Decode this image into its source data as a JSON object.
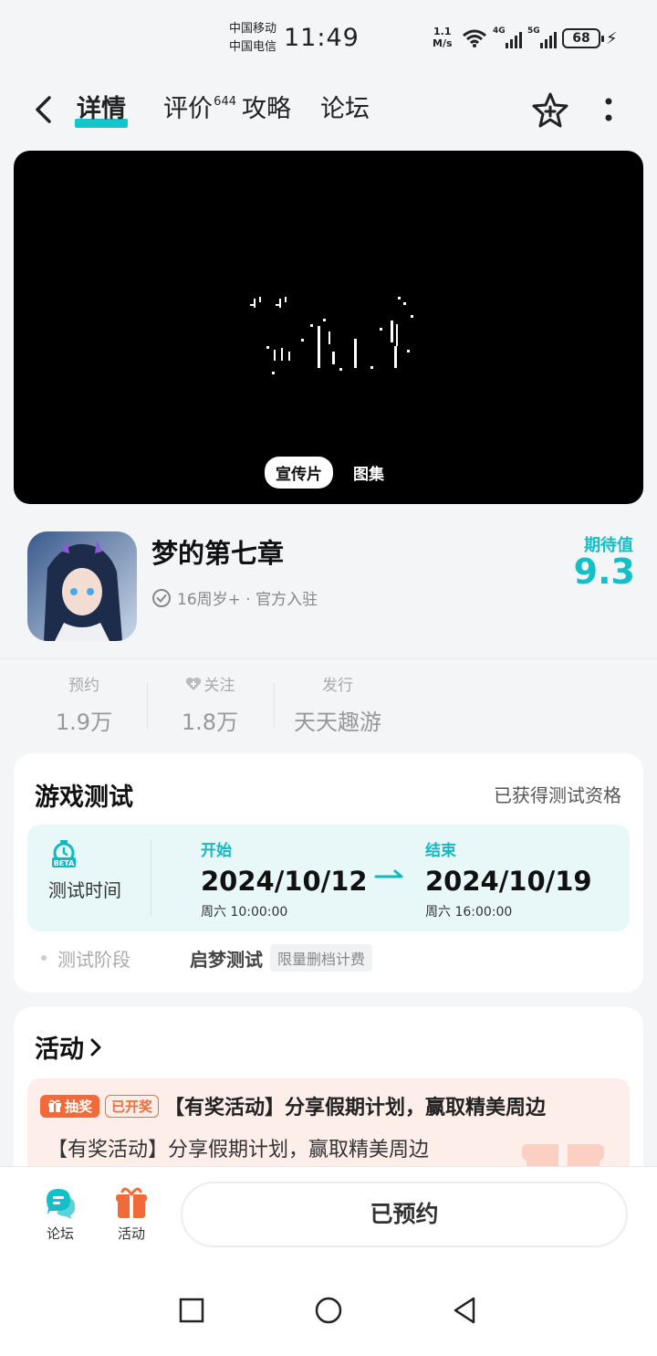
{
  "status_bar": {
    "carrier1": "中国移动",
    "carrier2": "中国电信",
    "time": "11:49",
    "net_speed_value": "1.1",
    "net_speed_unit": "M/s",
    "sig1_tag": "4G",
    "sig2_tag": "5G",
    "battery": "68"
  },
  "nav": {
    "tabs": [
      {
        "label": "详情"
      },
      {
        "label": "评价",
        "badge": "644"
      },
      {
        "label": "攻略"
      },
      {
        "label": "论坛"
      }
    ]
  },
  "media": {
    "tabs": [
      {
        "label": "宣传片"
      },
      {
        "label": "图集"
      }
    ]
  },
  "game": {
    "title": "梦的第七章",
    "meta": "16周岁+ · 官方入驻",
    "score_label": "期待值",
    "score_value": "9.3"
  },
  "stats": [
    {
      "label": "预约",
      "value": "1.9万"
    },
    {
      "label": "关注",
      "value": "1.8万"
    },
    {
      "label": "发行",
      "value": "天天趣游"
    }
  ],
  "test": {
    "title": "游戏测试",
    "status": "已获得测试资格",
    "time_label": "测试时间",
    "beta_text": "BETA",
    "start_label": "开始",
    "start_date": "2024/10/12",
    "start_time": "周六  10:00:00",
    "end_label": "结束",
    "end_date": "2024/10/19",
    "end_time": "周六  16:00:00",
    "stage_label": "测试阶段",
    "stage_value": "启梦测试",
    "stage_tag": "限量删档计费"
  },
  "activity": {
    "title": "活动",
    "tag_lottery": "抽奖",
    "tag_open": "已开奖",
    "headline": "【有奖活动】分享假期计划，赢取精美周边",
    "desc": "【有奖活动】分享假期计划，赢取精美周边"
  },
  "bottom": {
    "forum": "论坛",
    "activity": "活动",
    "reserve": "已预约"
  },
  "colors": {
    "accent": "#14c0c8",
    "orange": "#f36a3a"
  }
}
